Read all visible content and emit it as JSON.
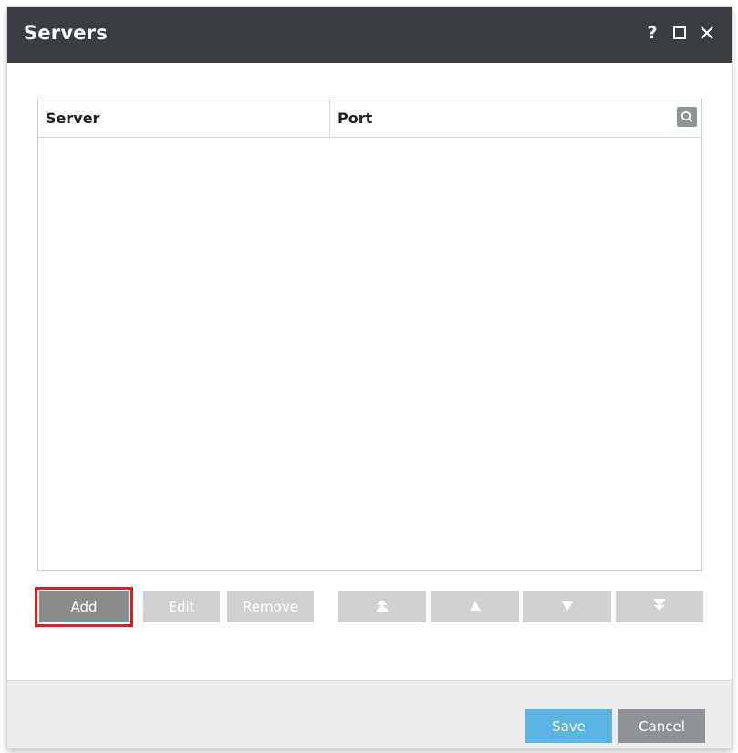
{
  "window": {
    "title": "Servers",
    "controls": {
      "help_label": "?",
      "maximize_icon": "maximize-icon",
      "close_icon": "close-icon"
    }
  },
  "table": {
    "columns": [
      {
        "label": "Server"
      },
      {
        "label": "Port"
      }
    ],
    "search_icon": "search-icon",
    "rows": []
  },
  "toolbar": {
    "add_label": "Add",
    "edit_label": "Edit",
    "remove_label": "Remove",
    "move_top_icon": "move-top-icon",
    "move_up_icon": "move-up-icon",
    "move_down_icon": "move-down-icon",
    "move_bottom_icon": "move-bottom-icon",
    "highlight_color": "#e11d1d"
  },
  "footer": {
    "save_label": "Save",
    "cancel_label": "Cancel",
    "save_color": "#5ab4e4",
    "cancel_color": "#8f9398"
  }
}
